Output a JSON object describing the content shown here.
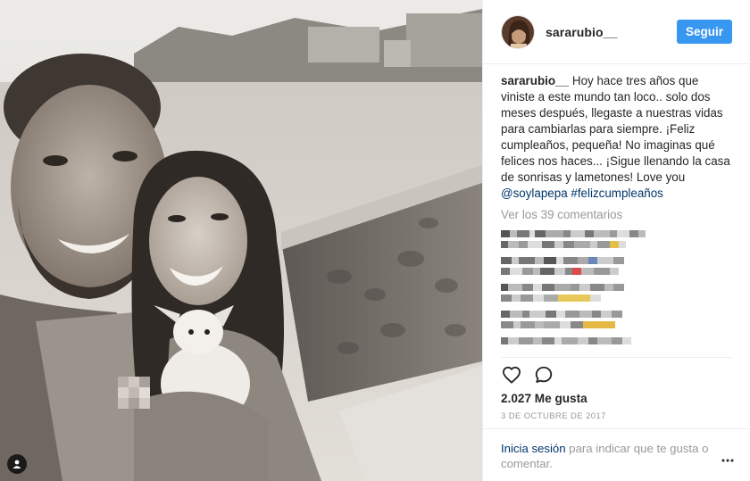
{
  "post": {
    "username": "sararubio__",
    "follow_label": "Seguir",
    "caption_author": "sararubio__",
    "caption_text": "Hoy hace tres años que viniste a este mundo tan loco.. solo dos meses después, llegaste a nuestras vidas para cambiarlas para siempre. ¡Feliz cumpleaños, pequeña! No imaginas qué felices nos haces... ¡Sigue llenando la casa de sonrisas y lametones! Love you ",
    "caption_tags": [
      "@soylapepa",
      "#felizcumpleaños"
    ],
    "view_comments": "Ver los 39 comentarios",
    "likes": "2.027 Me gusta",
    "date": "3 de octubre de 2017"
  },
  "footer": {
    "login_link": "Inicia sesión",
    "login_text": " para indicar que te gusta o comentar."
  },
  "icons": {
    "heart": "heart-icon",
    "comment": "comment-icon",
    "more": "more-icon",
    "tag": "user-tag-icon"
  },
  "colors": {
    "accent": "#3897f0",
    "link": "#003569",
    "muted": "#999999",
    "text": "#262626"
  }
}
